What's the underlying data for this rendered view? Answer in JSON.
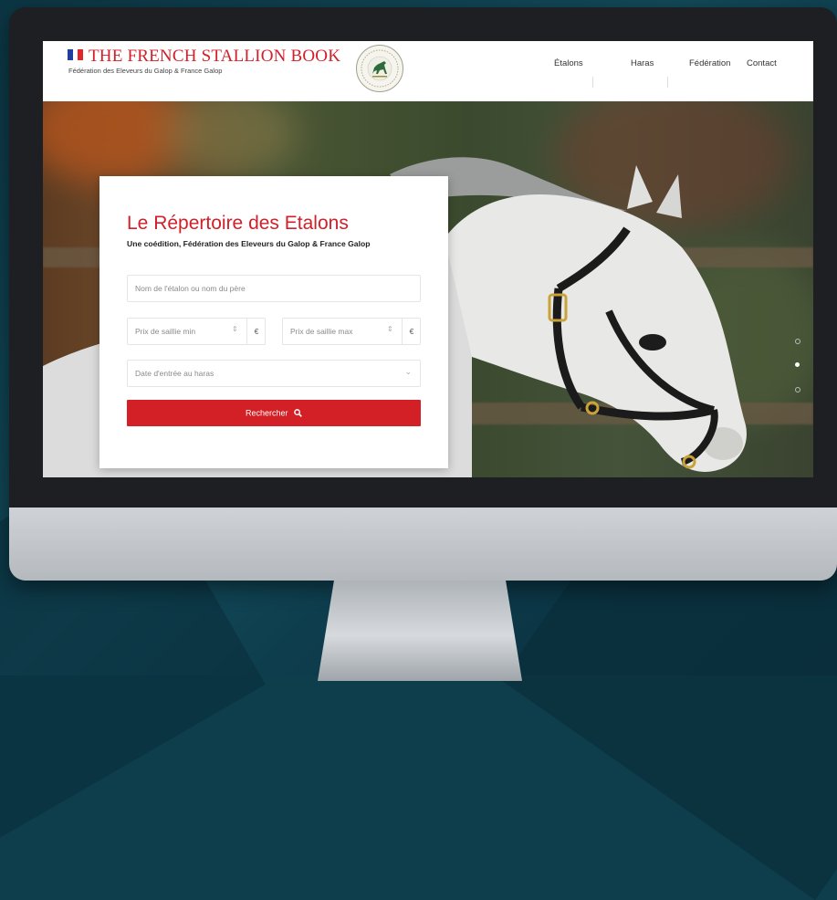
{
  "site": {
    "brand_title": "THE FRENCH STALLION BOOK",
    "brand_subtitle": "Fédération des Eleveurs du Galop & France Galop",
    "flag_colors": [
      "#1f3e9e",
      "#ffffff",
      "#e1252d"
    ],
    "logo_icon": "horse-seal-logo"
  },
  "nav": {
    "items": [
      {
        "label": "Étalons"
      },
      {
        "label": "Haras"
      },
      {
        "label": "Fédération"
      },
      {
        "label": "Contact"
      }
    ]
  },
  "search": {
    "title": "Le Répertoire des Etalons",
    "subtitle": "Une coédition, Fédération des Eleveurs du Galop & France Galop",
    "name_placeholder": "Nom de l'étalon ou nom du père",
    "price_min_placeholder": "Prix de saillie min",
    "price_max_placeholder": "Prix de saillie max",
    "currency": "€",
    "date_placeholder": "Date d'entrée au haras",
    "button_label": "Rechercher",
    "button_icon": "search-icon"
  },
  "colors": {
    "accent": "#d1202a",
    "button": "#d31f26"
  }
}
